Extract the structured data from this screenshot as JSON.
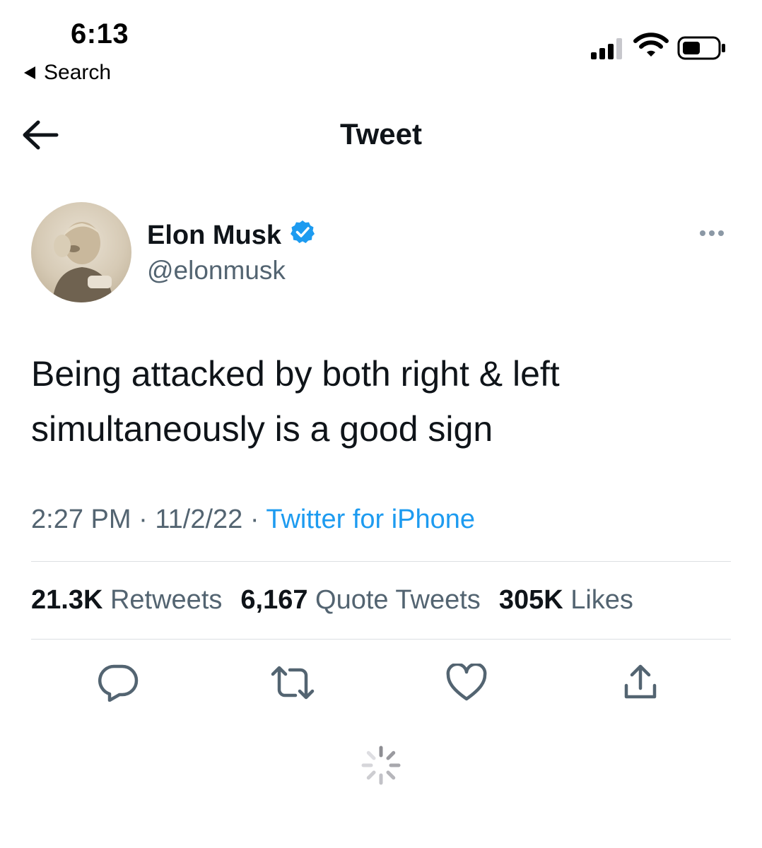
{
  "status_bar": {
    "time": "6:13",
    "back_label": "Search"
  },
  "header": {
    "title": "Tweet"
  },
  "author": {
    "name": "Elon Musk",
    "handle": "@elonmusk"
  },
  "tweet": {
    "text_line1": "Being attacked by both right & left",
    "text_line2": "simultaneously is a good sign",
    "time": "2:27 PM",
    "date": "11/2/22",
    "source": "Twitter for iPhone",
    "separator": "·"
  },
  "stats": {
    "retweets_count": "21.3K",
    "retweets_label": "Retweets",
    "quotes_count": "6,167",
    "quotes_label": "Quote Tweets",
    "likes_count": "305K",
    "likes_label": "Likes"
  },
  "icons": {
    "verified_color": "#1d9bf0",
    "link_color": "#1d9bf0"
  }
}
